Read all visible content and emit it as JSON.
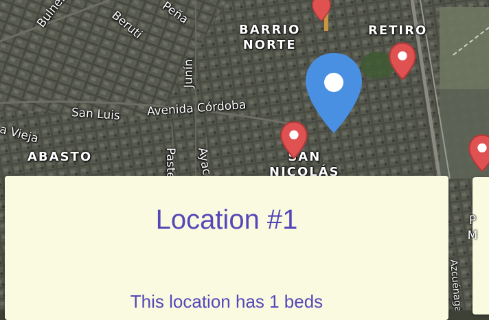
{
  "map": {
    "neighborhoods": [
      {
        "id": "barrio-norte",
        "text": "BARRIO\nNORTE"
      },
      {
        "id": "retiro",
        "text": "RETIRO"
      },
      {
        "id": "abasto",
        "text": "ABASTO"
      },
      {
        "id": "san-nicolas",
        "text": "SAN\nNICOLÁS"
      }
    ],
    "streets": {
      "bulnes": "Bulnes",
      "beruti": "Beruti",
      "pena": "Peña",
      "junin": "Junín",
      "san_luis": "San Luis",
      "cordoba": "Avenida Córdoba",
      "vieja": "a Vieja",
      "pasteur": "Paste",
      "ayacucho": "Ayac",
      "azcuenaga": "Azcuénaga"
    }
  },
  "markers": {
    "current_location_color": "#4a90e2",
    "pin_color": "#e05252"
  },
  "cards": [
    {
      "title": "Location #1",
      "description": "This location has 1 beds"
    },
    {
      "title": "P\nM",
      "description": ""
    }
  ],
  "colors": {
    "card_bg": "#fafae0",
    "card_text": "#5547b8"
  }
}
